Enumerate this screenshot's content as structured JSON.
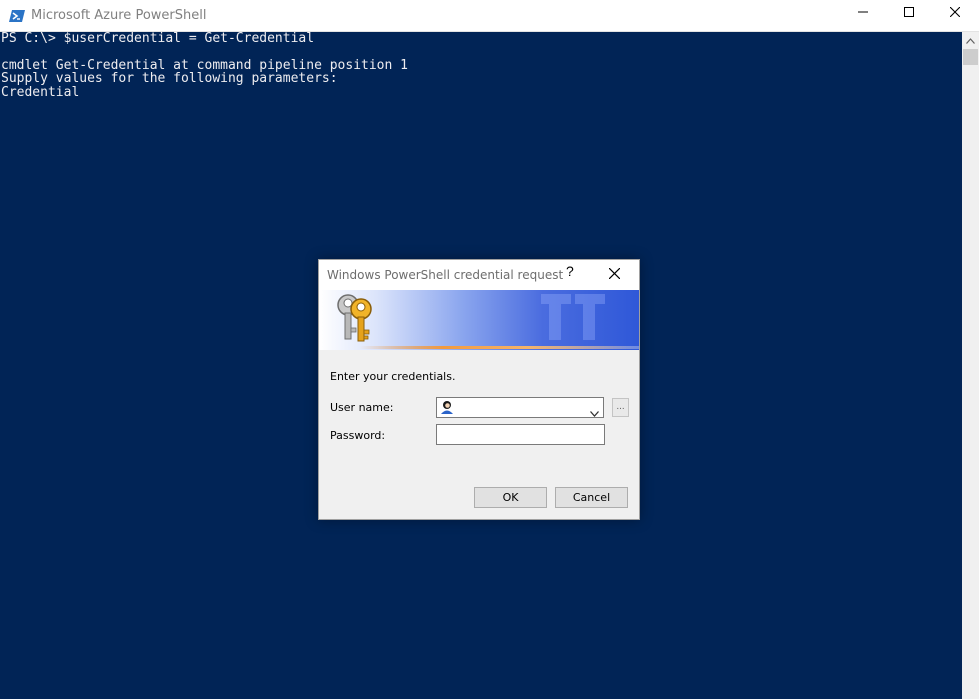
{
  "window": {
    "title": "Microsoft Azure PowerShell",
    "icon": "powershell-icon"
  },
  "console": {
    "lines": [
      "PS C:\\> $userCredential = Get-Credential",
      "",
      "cmdlet Get-Credential at command pipeline position 1",
      "Supply values for the following parameters:",
      "Credential"
    ]
  },
  "dialog": {
    "title": "Windows PowerShell credential request",
    "help_label": "?",
    "prompt": "Enter your credentials.",
    "user_label": "User name:",
    "user_value": "",
    "password_label": "Password:",
    "password_value": "",
    "browse_label": "...",
    "ok_label": "OK",
    "cancel_label": "Cancel"
  },
  "colors": {
    "console_bg": "#012456",
    "console_text": "#eeedf0",
    "dialog_bg": "#f0f0f0"
  }
}
